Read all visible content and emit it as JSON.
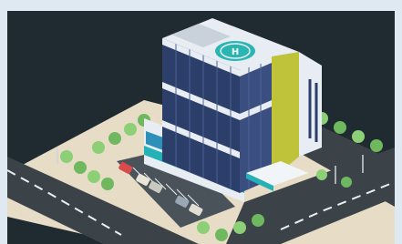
{
  "scene": {
    "subject": "isometric-hospital-building",
    "colors": {
      "frame": "#dfe9f1",
      "background": "#202a31",
      "ground": "#e7ddc6",
      "road": "#3b4349",
      "lane_mark": "#e8eef2",
      "facade_blue": "#2c3f6a",
      "facade_white": "#e8edf3",
      "accent_teal": "#25b2b6",
      "accent_lime": "#bfc33a",
      "helipad": "#2bb5b2",
      "sign_blue": "#2e8fb8",
      "tree": "#8ccf76",
      "tree_dark": "#6fb85f"
    },
    "signs": {
      "roof_helipad_letter": "H"
    }
  }
}
